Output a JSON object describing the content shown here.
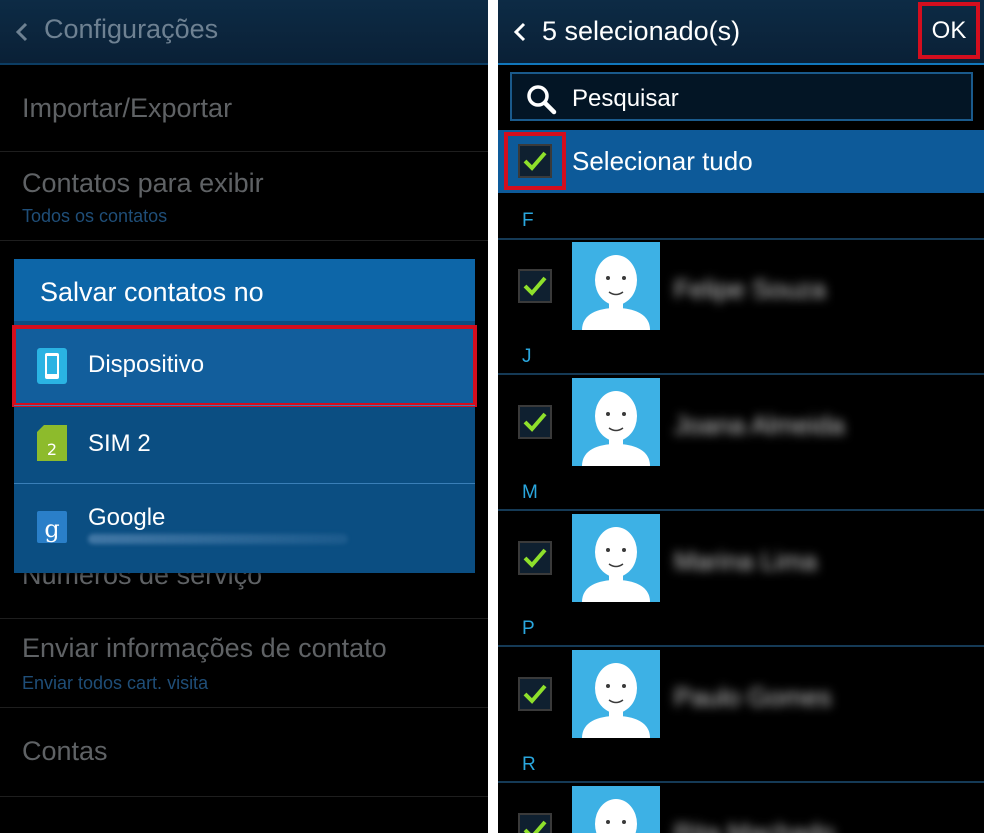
{
  "left": {
    "header_title": "Configurações",
    "items": [
      {
        "title": "Importar/Exportar",
        "subtitle": ""
      },
      {
        "title": "Contatos para exibir",
        "subtitle": "Todos os contatos"
      },
      {
        "title": "Números de serviço",
        "subtitle": ""
      },
      {
        "title": "Enviar informações de contato",
        "subtitle": "Enviar todos cart. visita"
      },
      {
        "title": "Contas",
        "subtitle": ""
      }
    ],
    "dialog": {
      "title": "Salvar contatos no",
      "options": [
        {
          "label": "Dispositivo",
          "icon": "phone-icon"
        },
        {
          "label": "SIM 2",
          "icon": "sim-card-icon",
          "badge": "2"
        },
        {
          "label": "Google",
          "icon": "google-icon",
          "badge": "g"
        }
      ]
    }
  },
  "right": {
    "header_title": "5 selecionado(s)",
    "ok_label": "OK",
    "search_placeholder": "Pesquisar",
    "select_all_label": "Selecionar tudo",
    "sections": [
      {
        "letter": "F",
        "contact": "Felipe Souza"
      },
      {
        "letter": "J",
        "contact": "Joana Almeida"
      },
      {
        "letter": "M",
        "contact": "Marina Lima"
      },
      {
        "letter": "P",
        "contact": "Paulo Gomes"
      },
      {
        "letter": "R",
        "contact": "Rita Machado"
      }
    ]
  },
  "colors": {
    "accent_blue": "#0d66a8",
    "highlight_red": "#d40e1e",
    "check_green": "#8ee02b",
    "avatar_blue": "#3db1e5"
  }
}
